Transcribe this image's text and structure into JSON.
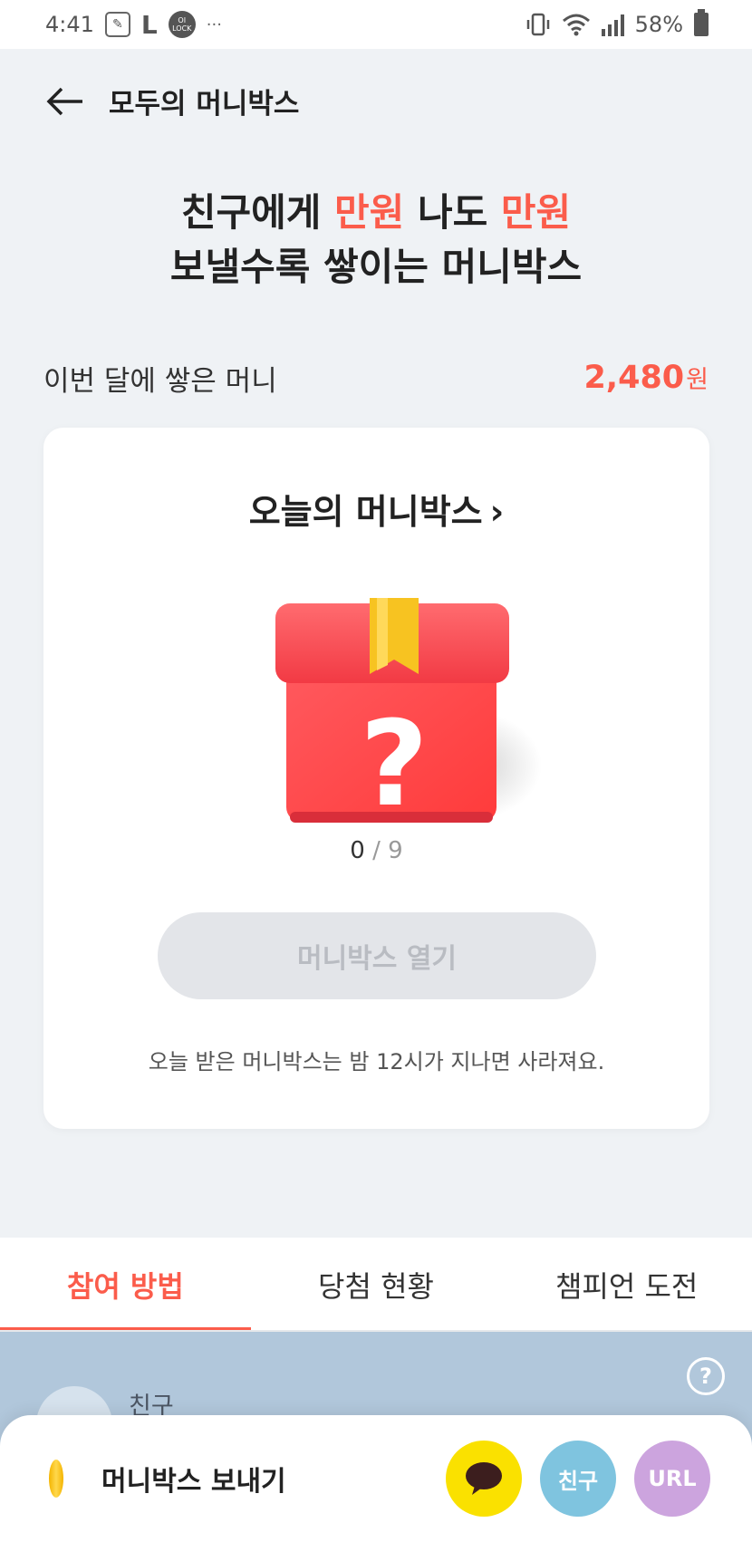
{
  "status_bar": {
    "time": "4:41",
    "lock_badge": "ОІ LOCK",
    "battery": "58%",
    "dots": "···"
  },
  "header": {
    "title": "모두의 머니박스"
  },
  "hero": {
    "line1_a": "친구에게 ",
    "line1_b": "만원",
    "line1_c": " 나도 ",
    "line1_d": "만원",
    "line2": "보낼수록 쌓이는 머니박스"
  },
  "monthly": {
    "label": "이번 달에 쌓은 머니",
    "value": "2,480",
    "unit": "원"
  },
  "card": {
    "title": "오늘의 머니박스",
    "chevron": "›",
    "counter_current": "0",
    "counter_sep": "/",
    "counter_total": "9",
    "open_button": "머니박스 열기",
    "note": "오늘 받은 머니박스는 밤 12시가 지나면 사라져요."
  },
  "tabs": [
    {
      "label": "참여 방법"
    },
    {
      "label": "당첨 현황"
    },
    {
      "label": "챔피언 도전"
    }
  ],
  "section": {
    "friend_label": "친구",
    "help": "?"
  },
  "bottom_sheet": {
    "label": "머니박스 보내기",
    "friend_button": "친구",
    "url_button": "URL"
  },
  "colors": {
    "accent": "#fb5c4b",
    "kakao": "#fae100",
    "friend": "#7fc4df",
    "url": "#cca4de"
  }
}
